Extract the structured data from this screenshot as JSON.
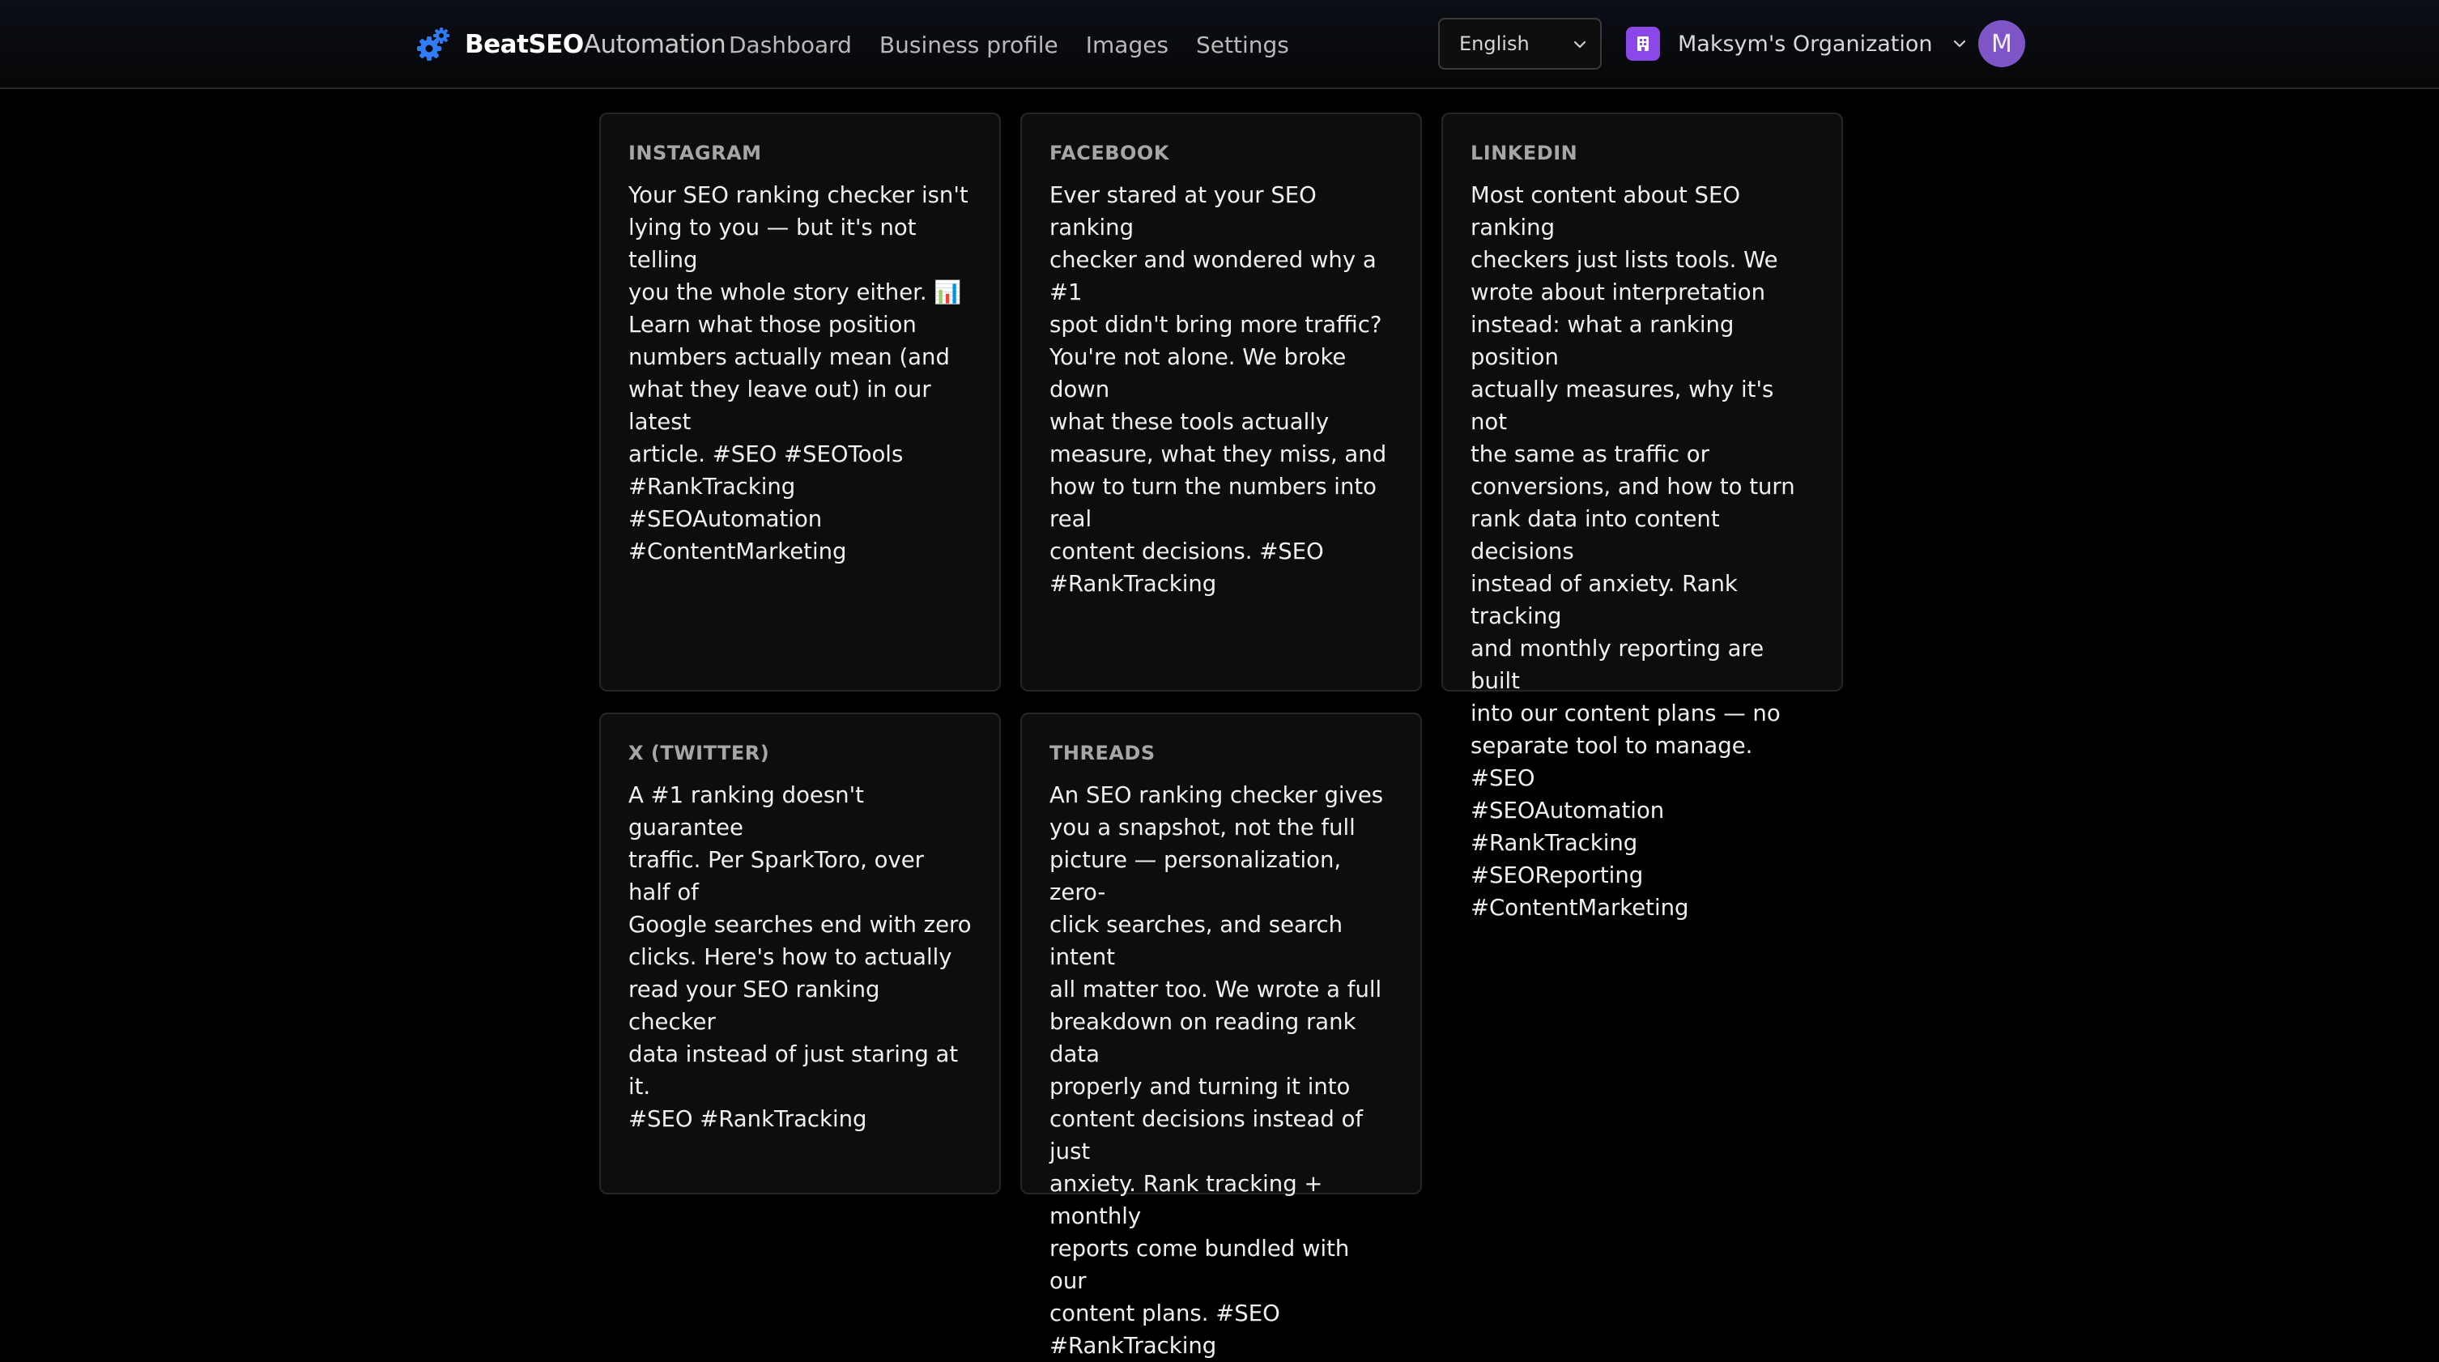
{
  "brand": {
    "name_bold": "BeatSEO",
    "name_regular": "Automation",
    "icon": "gears-icon",
    "accent": "#2f7cf6"
  },
  "nav": {
    "items": [
      "Dashboard",
      "Business profile",
      "Images",
      "Settings"
    ]
  },
  "language": {
    "selected": "English"
  },
  "org": {
    "name": "Maksym's Organization",
    "badge_color": "#8b47e8"
  },
  "user": {
    "initial": "M",
    "avatar_color": "#7d55c7"
  },
  "posts": [
    {
      "platform": "INSTAGRAM",
      "text": "Your SEO ranking checker isn't\nlying to you — but it's not telling\nyou the whole story either. 📊\nLearn what those position\nnumbers actually mean (and\nwhat they leave out) in our latest\narticle. #SEO #SEOTools\n#RankTracking #SEOAutomation\n#ContentMarketing"
    },
    {
      "platform": "FACEBOOK",
      "text": "Ever stared at your SEO ranking\nchecker and wondered why a #1\nspot didn't bring more traffic?\nYou're not alone. We broke down\nwhat these tools actually\nmeasure, what they miss, and\nhow to turn the numbers into real\ncontent decisions. #SEO\n#RankTracking"
    },
    {
      "platform": "LINKEDIN",
      "text": "Most content about SEO ranking\ncheckers just lists tools. We\nwrote about interpretation\ninstead: what a ranking position\nactually measures, why it's not\nthe same as traffic or\nconversions, and how to turn\nrank data into content decisions\ninstead of anxiety. Rank tracking\nand monthly reporting are built\ninto our content plans — no\nseparate tool to manage. #SEO\n#SEOAutomation #RankTracking\n#SEOReporting\n#ContentMarketing"
    },
    {
      "platform": "X (TWITTER)",
      "text": "A #1 ranking doesn't guarantee\ntraffic. Per SparkToro, over half of\nGoogle searches end with zero\nclicks. Here's how to actually\nread your SEO ranking checker\ndata instead of just staring at it.\n#SEO #RankTracking"
    },
    {
      "platform": "THREADS",
      "text": "An SEO ranking checker gives\nyou a snapshot, not the full\npicture — personalization, zero-\nclick searches, and search intent\nall matter too. We wrote a full\nbreakdown on reading rank data\nproperly and turning it into\ncontent decisions instead of just\nanxiety. Rank tracking + monthly\nreports come bundled with our\ncontent plans. #SEO\n#RankTracking"
    }
  ]
}
